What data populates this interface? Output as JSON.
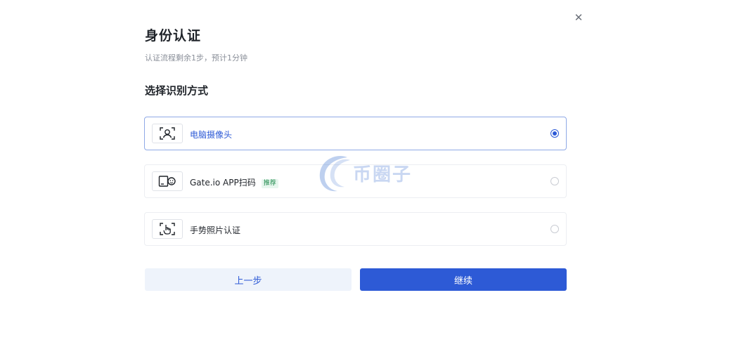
{
  "dialog": {
    "close_glyph": "✕",
    "title": "身份认证",
    "subtitle": "认证流程剩余1步，预计1分钟",
    "section_title": "选择识别方式"
  },
  "options": [
    {
      "label": "电脑摄像头",
      "icon": "face-scan-icon",
      "selected": true
    },
    {
      "label": "Gate.io APP扫码",
      "tag": "推荐",
      "icon": "phone-scan-icon",
      "selected": false
    },
    {
      "label": "手势照片认证",
      "icon": "hand-gesture-icon",
      "selected": false
    }
  ],
  "buttons": {
    "back_label": "上一步",
    "continue_label": "继续"
  },
  "watermark": {
    "text": "币圈子"
  },
  "colors": {
    "accent": "#2d5ad6",
    "selected_border": "#8fa9e6",
    "back_button_bg": "#eef3fb",
    "tag_text": "#1f8a4c",
    "tag_bg": "#e7f6ee"
  }
}
